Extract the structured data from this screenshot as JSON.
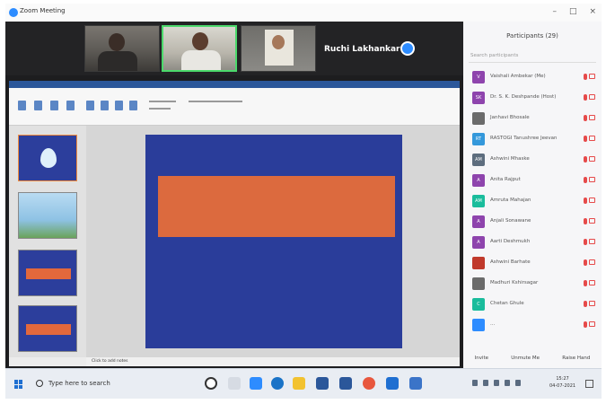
{
  "window": {
    "title": "Zoom Meeting",
    "controls": [
      "–",
      "□",
      "×"
    ]
  },
  "video_strip": {
    "active_speaker": "Ruchi Lakhankar"
  },
  "powerpoint": {
    "notes_label": "Click to add notes"
  },
  "participants_panel": {
    "title": "Participants (29)",
    "search_placeholder": "Search participants",
    "participants": [
      {
        "initials": "V",
        "name": "Vaishali Ambekar (Me)",
        "color": "#8e44ad"
      },
      {
        "initials": "SK",
        "name": "Dr. S. K. Deshpande (Host)",
        "color": "#8e44ad"
      },
      {
        "initials": "",
        "name": "Janhavi Bhosale",
        "color": "#6b6b6b"
      },
      {
        "initials": "RT",
        "name": "RASTOGI Tanushree Jeevan",
        "color": "#3498db"
      },
      {
        "initials": "AM",
        "name": "Ashwini Mhaske",
        "color": "#5d6d7e"
      },
      {
        "initials": "A",
        "name": "Anita Rajput",
        "color": "#8e44ad"
      },
      {
        "initials": "AM",
        "name": "Amruta Mahajan",
        "color": "#1abc9c"
      },
      {
        "initials": "A",
        "name": "Anjali Sonawane",
        "color": "#8e44ad"
      },
      {
        "initials": "A",
        "name": "Aarti Deshmukh",
        "color": "#8e44ad"
      },
      {
        "initials": "",
        "name": "Ashwini Barhate",
        "color": "#c0392b"
      },
      {
        "initials": "",
        "name": "Madhuri Kshirsagar",
        "color": "#6b6b6b"
      },
      {
        "initials": "C",
        "name": "Chetan Ghule",
        "color": "#1abc9c"
      },
      {
        "initials": "",
        "name": "...",
        "color": "#2d8cff"
      }
    ],
    "footer": [
      "Invite",
      "Unmute Me",
      "Raise Hand"
    ]
  },
  "taskbar": {
    "search_placeholder": "Type here to search",
    "clock_time": "15:27",
    "clock_date": "04-07-2021"
  }
}
